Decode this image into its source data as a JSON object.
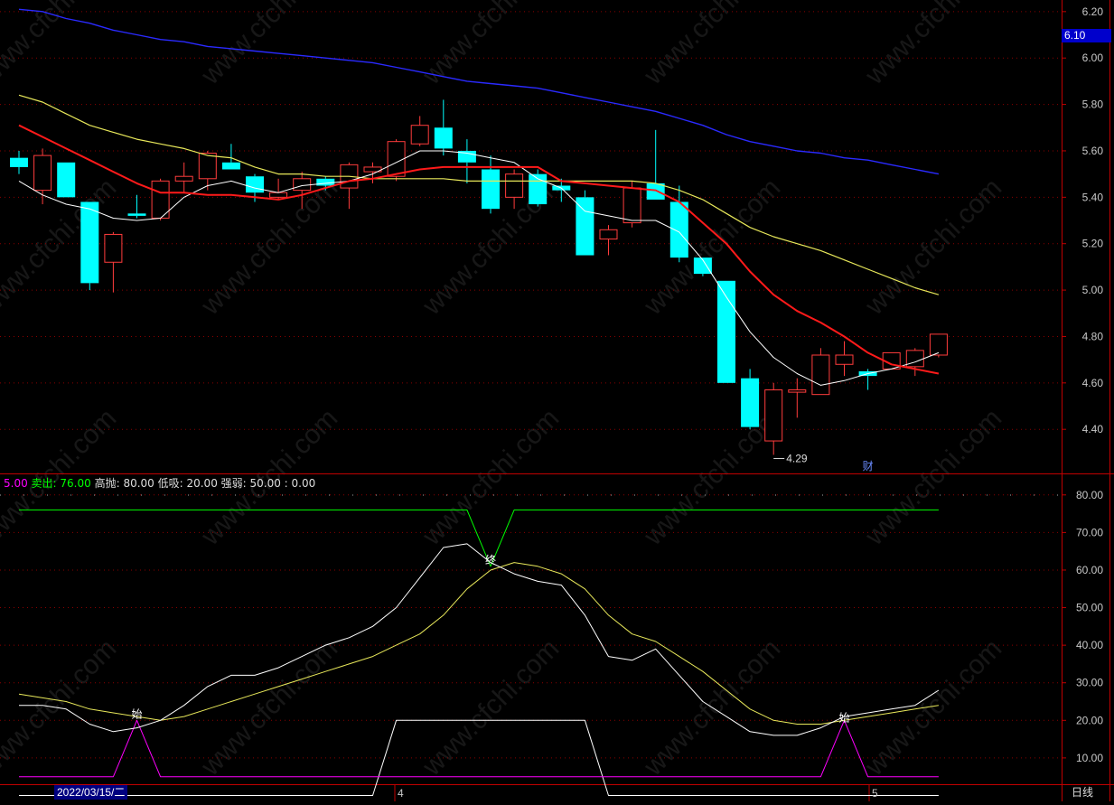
{
  "watermark_text": "www.cfchi.com",
  "current_price_tag": "6.10",
  "low_marker_label": "4.29",
  "finance_marker": "财",
  "date_label": "2022/03/15/二",
  "month_labels": [
    "4",
    "5"
  ],
  "period_label": "日线",
  "indicator_legend": {
    "buy": "5.00",
    "sell": "卖出: 76.00",
    "rest": "高抛: 80.00  低吸: 20.00  强弱: 50.00 : 0.00"
  },
  "signal_labels": {
    "start": "始",
    "end": "终"
  },
  "colors": {
    "up_candle": "#ff3c3c",
    "down_candle": "#00ffff",
    "ma_short": "#ffffff",
    "ma_red": "#ff1a1a",
    "ma_yellow": "#e8e85a",
    "ma_blue": "#2a2aff",
    "axis": "#c00000",
    "kdj_k": "#ffffff",
    "kdj_d": "#e8e85a",
    "sell_line": "#00ff00",
    "buy_line": "#ff00ff",
    "zone_line": "#ffffff"
  },
  "chart_data": [
    {
      "type": "candlestick",
      "ylim": [
        4.21,
        6.25
      ],
      "y_ticks": [
        "6.20",
        "6.00",
        "5.80",
        "5.60",
        "5.40",
        "5.20",
        "5.00",
        "4.80",
        "4.60",
        "4.40"
      ],
      "candles": [
        {
          "o": 5.57,
          "h": 5.6,
          "l": 5.5,
          "c": 5.53
        },
        {
          "o": 5.43,
          "h": 5.61,
          "l": 5.37,
          "c": 5.58
        },
        {
          "o": 5.55,
          "h": 5.55,
          "l": 5.4,
          "c": 5.4
        },
        {
          "o": 5.38,
          "h": 5.38,
          "l": 5.0,
          "c": 5.03
        },
        {
          "o": 5.12,
          "h": 5.25,
          "l": 4.99,
          "c": 5.24
        },
        {
          "o": 5.33,
          "h": 5.41,
          "l": 5.31,
          "c": 5.32
        },
        {
          "o": 5.31,
          "h": 5.48,
          "l": 5.3,
          "c": 5.47
        },
        {
          "o": 5.47,
          "h": 5.55,
          "l": 5.42,
          "c": 5.49
        },
        {
          "o": 5.48,
          "h": 5.6,
          "l": 5.43,
          "c": 5.59
        },
        {
          "o": 5.55,
          "h": 5.63,
          "l": 5.52,
          "c": 5.52
        },
        {
          "o": 5.49,
          "h": 5.5,
          "l": 5.38,
          "c": 5.42
        },
        {
          "o": 5.4,
          "h": 5.48,
          "l": 5.39,
          "c": 5.42
        },
        {
          "o": 5.43,
          "h": 5.51,
          "l": 5.35,
          "c": 5.48
        },
        {
          "o": 5.48,
          "h": 5.49,
          "l": 5.43,
          "c": 5.45
        },
        {
          "o": 5.44,
          "h": 5.55,
          "l": 5.35,
          "c": 5.54
        },
        {
          "o": 5.51,
          "h": 5.55,
          "l": 5.46,
          "c": 5.53
        },
        {
          "o": 5.49,
          "h": 5.65,
          "l": 5.47,
          "c": 5.64
        },
        {
          "o": 5.63,
          "h": 5.75,
          "l": 5.62,
          "c": 5.71
        },
        {
          "o": 5.7,
          "h": 5.82,
          "l": 5.58,
          "c": 5.61
        },
        {
          "o": 5.6,
          "h": 5.65,
          "l": 5.46,
          "c": 5.55
        },
        {
          "o": 5.52,
          "h": 5.58,
          "l": 5.33,
          "c": 5.35
        },
        {
          "o": 5.4,
          "h": 5.52,
          "l": 5.35,
          "c": 5.5
        },
        {
          "o": 5.5,
          "h": 5.52,
          "l": 5.36,
          "c": 5.37
        },
        {
          "o": 5.45,
          "h": 5.48,
          "l": 5.38,
          "c": 5.43
        },
        {
          "o": 5.4,
          "h": 5.43,
          "l": 5.15,
          "c": 5.15
        },
        {
          "o": 5.22,
          "h": 5.28,
          "l": 5.15,
          "c": 5.26
        },
        {
          "o": 5.29,
          "h": 5.47,
          "l": 5.27,
          "c": 5.44
        },
        {
          "o": 5.46,
          "h": 5.69,
          "l": 5.39,
          "c": 5.39
        },
        {
          "o": 5.38,
          "h": 5.45,
          "l": 5.12,
          "c": 5.14
        },
        {
          "o": 5.14,
          "h": 5.14,
          "l": 5.06,
          "c": 5.07
        },
        {
          "o": 5.04,
          "h": 5.04,
          "l": 4.6,
          "c": 4.6
        },
        {
          "o": 4.62,
          "h": 4.66,
          "l": 4.4,
          "c": 4.41
        },
        {
          "o": 4.35,
          "h": 4.6,
          "l": 4.29,
          "c": 4.57
        },
        {
          "o": 4.56,
          "h": 4.62,
          "l": 4.45,
          "c": 4.57
        },
        {
          "o": 4.55,
          "h": 4.75,
          "l": 4.55,
          "c": 4.72
        },
        {
          "o": 4.68,
          "h": 4.78,
          "l": 4.63,
          "c": 4.72
        },
        {
          "o": 4.65,
          "h": 4.66,
          "l": 4.57,
          "c": 4.63
        },
        {
          "o": 4.66,
          "h": 4.73,
          "l": 4.66,
          "c": 4.73
        },
        {
          "o": 4.67,
          "h": 4.75,
          "l": 4.63,
          "c": 4.74
        },
        {
          "o": 4.72,
          "h": 4.81,
          "l": 4.71,
          "c": 4.81
        }
      ],
      "ma_white": [
        5.47,
        5.41,
        5.37,
        5.35,
        5.31,
        5.3,
        5.31,
        5.4,
        5.45,
        5.47,
        5.44,
        5.42,
        5.45,
        5.46,
        5.47,
        5.5,
        5.55,
        5.6,
        5.6,
        5.59,
        5.57,
        5.55,
        5.48,
        5.44,
        5.34,
        5.32,
        5.3,
        5.3,
        5.25,
        5.13,
        4.97,
        4.82,
        4.71,
        4.64,
        4.59,
        4.61,
        4.64,
        4.66,
        4.69,
        4.73
      ],
      "ma_red": [
        5.71,
        5.66,
        5.61,
        5.56,
        5.51,
        5.46,
        5.42,
        5.42,
        5.41,
        5.41,
        5.4,
        5.39,
        5.41,
        5.44,
        5.47,
        5.48,
        5.5,
        5.52,
        5.53,
        5.53,
        5.53,
        5.53,
        5.53,
        5.47,
        5.46,
        5.45,
        5.44,
        5.43,
        5.38,
        5.29,
        5.2,
        5.08,
        4.98,
        4.91,
        4.86,
        4.8,
        4.73,
        4.68,
        4.66,
        4.64
      ],
      "ma_yellow": [
        5.84,
        5.81,
        5.76,
        5.71,
        5.68,
        5.65,
        5.63,
        5.61,
        5.58,
        5.57,
        5.53,
        5.5,
        5.5,
        5.49,
        5.49,
        5.48,
        5.48,
        5.48,
        5.48,
        5.47,
        5.47,
        5.47,
        5.47,
        5.47,
        5.47,
        5.47,
        5.47,
        5.46,
        5.43,
        5.39,
        5.33,
        5.27,
        5.23,
        5.2,
        5.17,
        5.13,
        5.09,
        5.05,
        5.01,
        4.98
      ],
      "ma_blue": [
        6.21,
        6.2,
        6.17,
        6.15,
        6.12,
        6.1,
        6.08,
        6.07,
        6.05,
        6.04,
        6.03,
        6.02,
        6.01,
        6.0,
        5.99,
        5.98,
        5.96,
        5.94,
        5.92,
        5.9,
        5.89,
        5.88,
        5.87,
        5.85,
        5.83,
        5.81,
        5.79,
        5.77,
        5.74,
        5.71,
        5.67,
        5.64,
        5.62,
        5.6,
        5.59,
        5.57,
        5.56,
        5.54,
        5.52,
        5.5
      ],
      "annotations": [
        {
          "text": "4.29",
          "candle_index": 32,
          "value": 4.29
        },
        {
          "text": "财",
          "candle_index": 36
        }
      ]
    },
    {
      "type": "line",
      "ylim": [
        3,
        85
      ],
      "y_ticks": [
        "80.00",
        "70.00",
        "60.00",
        "50.00",
        "40.00",
        "30.00",
        "20.00",
        "10.00"
      ],
      "series": [
        {
          "key": "k",
          "values": [
            24,
            24,
            23,
            19,
            17,
            18,
            20,
            24,
            29,
            32,
            32,
            34,
            37,
            40,
            42,
            45,
            50,
            58,
            66,
            67,
            62,
            59,
            57,
            56,
            48,
            37,
            36,
            39,
            32,
            25,
            21,
            17,
            16,
            16,
            18,
            21,
            22,
            23,
            24,
            28
          ]
        },
        {
          "key": "d",
          "values": [
            27,
            26,
            25,
            23,
            22,
            21,
            20,
            21,
            23,
            25,
            27,
            29,
            31,
            33,
            35,
            37,
            40,
            43,
            48,
            55,
            60,
            62,
            61,
            59,
            55,
            48,
            43,
            41,
            37,
            33,
            28,
            23,
            20,
            19,
            19,
            20,
            21,
            22,
            23,
            24
          ]
        },
        {
          "key": "sell",
          "values": [
            76,
            76,
            76,
            76,
            76,
            76,
            76,
            76,
            76,
            76,
            76,
            76,
            76,
            76,
            76,
            76,
            76,
            76,
            76,
            76,
            61,
            76,
            76,
            76,
            76,
            76,
            76,
            76,
            76,
            76,
            76,
            76,
            76,
            76,
            76,
            76,
            76,
            76,
            76,
            76
          ]
        },
        {
          "key": "buy",
          "values": [
            5,
            5,
            5,
            5,
            5,
            20,
            5,
            5,
            5,
            5,
            5,
            5,
            5,
            5,
            5,
            5,
            5,
            5,
            5,
            5,
            5,
            5,
            5,
            5,
            5,
            5,
            5,
            5,
            5,
            5,
            5,
            5,
            5,
            5,
            5,
            20,
            5,
            5,
            5,
            5
          ]
        },
        {
          "key": "zone",
          "values": [
            0,
            0,
            0,
            0,
            0,
            0,
            0,
            0,
            0,
            0,
            0,
            0,
            0,
            0,
            0,
            0,
            20,
            20,
            20,
            20,
            20,
            20,
            20,
            20,
            20,
            0,
            0,
            0,
            0,
            0,
            0,
            0,
            0,
            0,
            0,
            0,
            0,
            0,
            0,
            0
          ]
        }
      ],
      "signals": [
        {
          "text": "始",
          "index": 5,
          "value": 20
        },
        {
          "text": "终",
          "index": 20,
          "value": 61
        },
        {
          "text": "始",
          "index": 35,
          "value": 19
        }
      ]
    }
  ]
}
